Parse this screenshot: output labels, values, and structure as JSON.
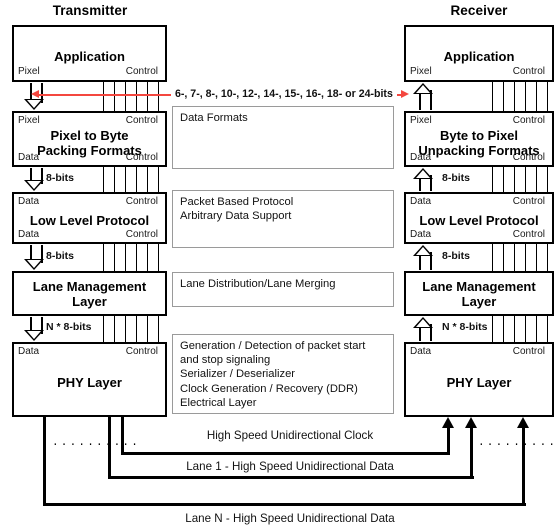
{
  "diagram": {
    "columns": {
      "transmitter": "Transmitter",
      "receiver": "Receiver"
    },
    "port_labels": {
      "pixel": "Pixel",
      "control": "Control",
      "data": "Data"
    },
    "transmitter_stack": [
      {
        "name": "Application",
        "top_ports": [],
        "bottom_ports": [
          "Pixel",
          "Control"
        ]
      },
      {
        "name": "Pixel to Byte\nPacking Formats",
        "top_ports": [
          "Pixel",
          "Control"
        ],
        "bottom_ports": [
          "Data",
          "Control"
        ]
      },
      {
        "name": "Low Level Protocol",
        "top_ports": [
          "Data",
          "Control"
        ],
        "bottom_ports": [
          "Data",
          "Control"
        ]
      },
      {
        "name": "Lane Management\nLayer",
        "top_ports": [],
        "bottom_ports": []
      },
      {
        "name": "PHY Layer",
        "top_ports": [
          "Data",
          "Control"
        ],
        "bottom_ports": []
      }
    ],
    "receiver_stack": [
      {
        "name": "Application",
        "bottom_ports": [
          "Pixel",
          "Control"
        ]
      },
      {
        "name": "Byte to Pixel\nUnpacking Formats",
        "top_ports": [
          "Pixel",
          "Control"
        ],
        "bottom_ports": [
          "Data",
          "Control"
        ]
      },
      {
        "name": "Low Level Protocol",
        "top_ports": [
          "Data",
          "Control"
        ],
        "bottom_ports": [
          "Data",
          "Control"
        ]
      },
      {
        "name": "Lane Management\nLayer",
        "top_ports": [],
        "bottom_ports": []
      },
      {
        "name": "PHY Layer",
        "top_ports": [
          "Data",
          "Control"
        ],
        "bottom_ports": []
      }
    ],
    "bit_widths": {
      "packing_to_llp": "8-bits",
      "llp_to_lane": "8-bits",
      "lane_to_phy": "N * 8-bits"
    },
    "pixel_bus_annotation": "6-, 7-, 8-, 10-, 12-, 14-, 15-, 16-, 18- or 24-bits",
    "descriptions": [
      {
        "id": "data-formats",
        "text": "Data Formats"
      },
      {
        "id": "low-level-protocol",
        "text": "Packet Based Protocol\nArbitrary Data Support"
      },
      {
        "id": "lane-management",
        "text": "Lane Distribution/Lane Merging"
      },
      {
        "id": "phy",
        "text": "Generation / Detection of packet start\nand stop signaling\nSerializer / Deserializer\nClock Generation / Recovery (DDR)\nElectrical Layer"
      }
    ],
    "links": [
      {
        "id": "clock",
        "label": "High Speed Unidirectional Clock"
      },
      {
        "id": "lane-1",
        "label": "Lane 1 - High Speed Unidirectional Data"
      },
      {
        "id": "lane-n",
        "label": "Lane N - High Speed Unidirectional Data"
      }
    ],
    "ellipsis": "..........",
    "colors": {
      "accent_red": "#f4473f",
      "box_border": "#000000",
      "desc_border": "#9a9a9a",
      "background": "#ffffff"
    }
  }
}
